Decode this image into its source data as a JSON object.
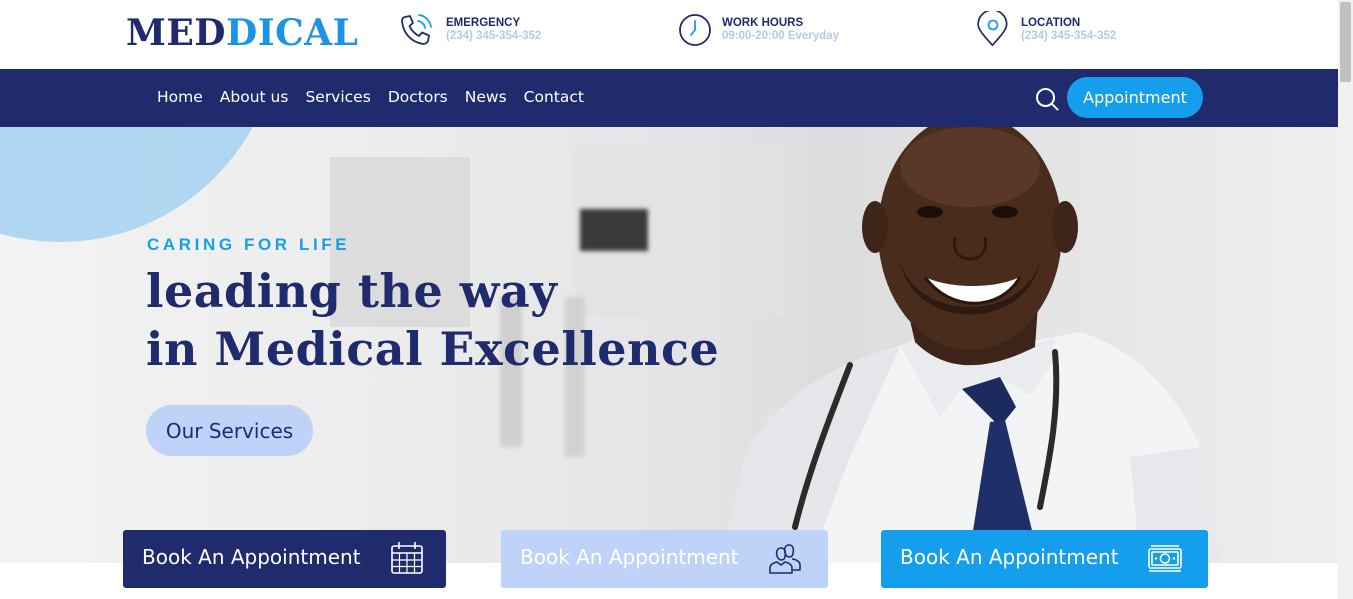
{
  "brand": {
    "logo_part1": "MED",
    "logo_part2": "DICAL"
  },
  "header_info": [
    {
      "icon": "phone-icon",
      "title": "EMERGENCY",
      "value": "(234) 345-354-352"
    },
    {
      "icon": "clock-icon",
      "title": "WORK HOURS",
      "value": "09:00-20:00 Everyday"
    },
    {
      "icon": "location-pin-icon",
      "title": "LOCATION",
      "value": "(234) 345-354-352"
    }
  ],
  "nav": {
    "links": [
      "Home",
      "About us",
      "Services",
      "Doctors",
      "News",
      "Contact"
    ],
    "search_icon": "search-icon",
    "appointment_label": "Appointment"
  },
  "hero": {
    "kicker": "CARING FOR LIFE",
    "headline_line1": "leading the way",
    "headline_line2": "in Medical Excellence",
    "cta_label": "Our Services"
  },
  "booking_cards": [
    {
      "label": "Book An Appointment",
      "icon": "calendar-icon"
    },
    {
      "label": "Book An Appointment",
      "icon": "people-icon"
    },
    {
      "label": "Book An Appointment",
      "icon": "money-icon"
    }
  ],
  "colors": {
    "navy": "#1f2b6c",
    "accent_blue": "#159eec",
    "light_blue": "#bfd2f8",
    "muted_text": "#b8c8ea"
  }
}
